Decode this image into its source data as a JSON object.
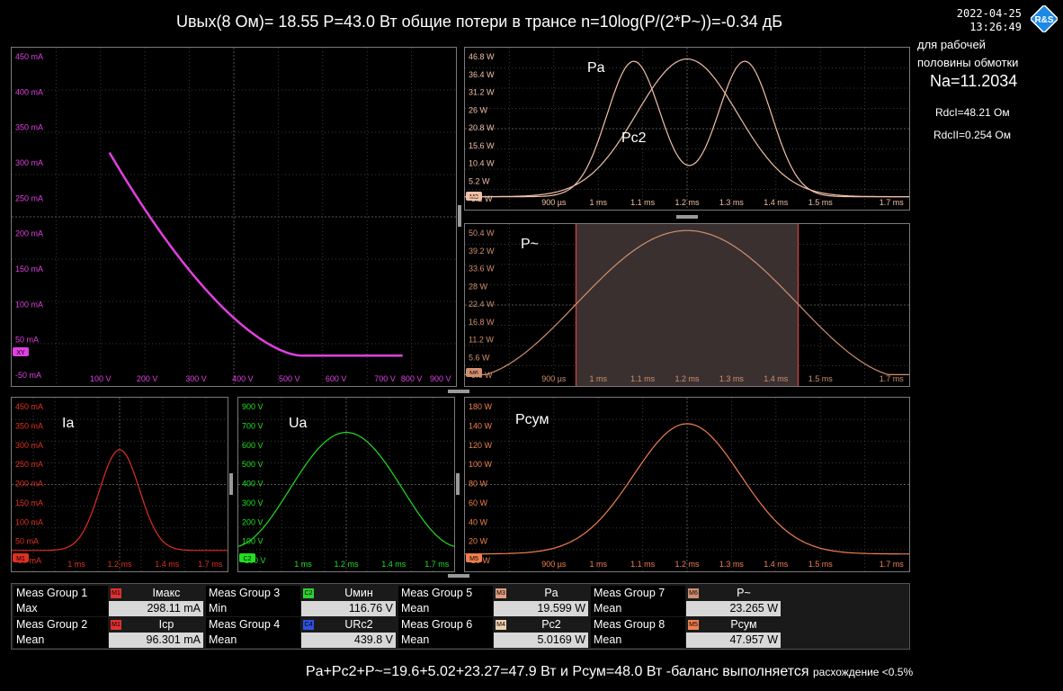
{
  "header": {
    "title": "Uвых(8 Ом)= 18.55  P=43.0 Вт   общие потери в трансе n=10log(P/(2*P~))=-0.34 дБ",
    "date": "2022-04-25",
    "time": "13:26:49"
  },
  "side_notes": {
    "line1": "для рабочей",
    "line2": "половины обмотки",
    "na": "Na=11.2034",
    "rdc1": "RdcI=48.21 Ом",
    "rdc2": "RdcII=0.254 Ом"
  },
  "panels": {
    "xy": {
      "y_ticks": [
        "450 mA",
        "400 mA",
        "350 mA",
        "300 mA",
        "250 mA",
        "200 mA",
        "150 mA",
        "100 mA",
        "50 mA",
        "-50 mA"
      ],
      "x_ticks": [
        "100 V",
        "200 V",
        "300 V",
        "400 V",
        "500 V",
        "600 V",
        "700 V",
        "800 V",
        "900 V"
      ],
      "marker": "XY",
      "color": "#e040e0"
    },
    "power": {
      "y_ticks": [
        "46.8 W",
        "36.4 W",
        "31.2 W",
        "26 W",
        "20.8 W",
        "15.6 W",
        "10.4 W",
        "5.2 W",
        "-5.2 W"
      ],
      "x_ticks": [
        "900 µs",
        "1 ms",
        "1.1 ms",
        "1.2 ms",
        "1.3 ms",
        "1.4 ms",
        "1.5 ms",
        "1.7 ms"
      ],
      "label_pa": "Pa",
      "label_pc2": "Pc2",
      "marker": "M3",
      "color": "#f0c0a8"
    },
    "ptilde": {
      "y_ticks": [
        "50.4 W",
        "39.2 W",
        "33.6 W",
        "28 W",
        "22.4 W",
        "16.8 W",
        "11.2 W",
        "5.6 W",
        "-5.6 W"
      ],
      "x_ticks": [
        "900 µs",
        "1 ms",
        "1.1 ms",
        "1.2 ms",
        "1.3 ms",
        "1.4 ms",
        "1.5 ms",
        "1.7 ms"
      ],
      "label": "P~",
      "marker": "M6",
      "color": "#d09070"
    },
    "ia": {
      "y_ticks": [
        "450 mA",
        "350 mA",
        "300 mA",
        "250 mA",
        "200 mA",
        "150 mA",
        "100 mA",
        "50 mA",
        "-50 mA"
      ],
      "x_ticks": [
        "1 ms",
        "1.2 ms",
        "1.4 ms",
        "1.7 ms"
      ],
      "label": "Ia",
      "marker": "M1",
      "color": "#e03020"
    },
    "ua": {
      "y_ticks": [
        "900 V",
        "700 V",
        "600 V",
        "500 V",
        "400 V",
        "300 V",
        "200 V",
        "100 V",
        "-100 V"
      ],
      "x_ticks": [
        "1 ms",
        "1.2 ms",
        "1.4 ms",
        "1.7 ms"
      ],
      "label": "Ua",
      "marker": "C2",
      "color": "#20e020"
    },
    "psum": {
      "y_ticks": [
        "180 W",
        "140 W",
        "120 W",
        "100 W",
        "80 W",
        "60 W",
        "40 W",
        "20 W",
        "-20 W"
      ],
      "x_ticks": [
        "900 µs",
        "1 ms",
        "1.1 ms",
        "1.2 ms",
        "1.3 ms",
        "1.4 ms",
        "1.5 ms",
        "1.7 ms"
      ],
      "label": "Pсум",
      "marker": "M5",
      "color": "#f08050"
    }
  },
  "measurements": [
    {
      "group": "Meas Group 1",
      "badge": "M1",
      "badge_color": "#e03030",
      "name": "Iмакс",
      "stat": "Max",
      "value": "298.11 mA"
    },
    {
      "group": "Meas Group 2",
      "badge": "M1",
      "badge_color": "#e03030",
      "name": "Icp",
      "stat": "Mean",
      "value": "96.301 mA"
    },
    {
      "group": "Meas Group 3",
      "badge": "C2",
      "badge_color": "#30d030",
      "name": "Uмин",
      "stat": "Min",
      "value": "116.76 V"
    },
    {
      "group": "Meas Group 4",
      "badge": "C4",
      "badge_color": "#3050e0",
      "name": "URc2",
      "stat": "Mean",
      "value": "439.8 V"
    },
    {
      "group": "Meas Group 5",
      "badge": "M3",
      "badge_color": "#e0a080",
      "name": "Pa",
      "stat": "Mean",
      "value": "19.599 W"
    },
    {
      "group": "Meas Group 6",
      "badge": "M4",
      "badge_color": "#f0d0b0",
      "name": "Pc2",
      "stat": "Mean",
      "value": "5.0169 W"
    },
    {
      "group": "Meas Group 7",
      "badge": "M6",
      "badge_color": "#d09070",
      "name": "P~",
      "stat": "Mean",
      "value": "23.265 W"
    },
    {
      "group": "Meas Group 8",
      "badge": "M5",
      "badge_color": "#f08050",
      "name": "Pсум",
      "stat": "Mean",
      "value": "47.957 W"
    }
  ],
  "footer": {
    "balance": "Pa+Pc2+P~=19.6+5.02+23.27=47.9 Вт   и   Pсум=48.0 Вт  -баланс выполняется",
    "note": "расхождение <0.5%"
  }
}
